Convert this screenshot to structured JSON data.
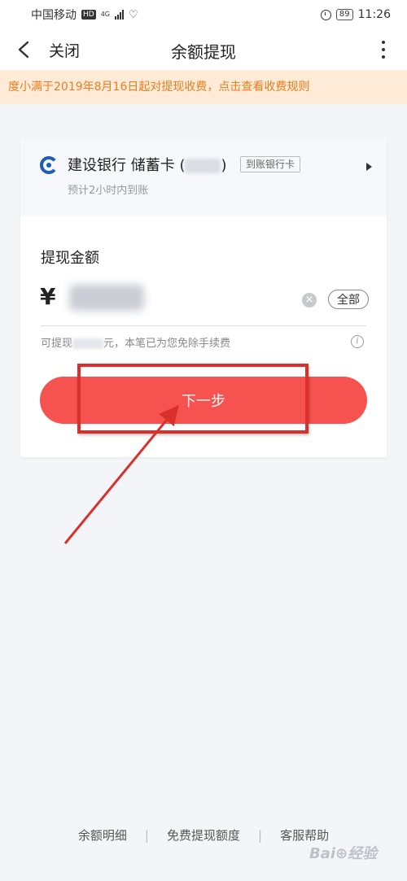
{
  "status_bar": {
    "carrier": "中国移动",
    "hd_badge": "HD",
    "network": "4G",
    "battery": "89",
    "time": "11:26"
  },
  "nav": {
    "close_label": "关闭",
    "title": "余额提现"
  },
  "notice": {
    "text": "度小满于2019年8月16日起对提现收费，点击查看收费规则",
    "color": "#f07c1b"
  },
  "bank": {
    "name": "建设银行 储蓄卡 (",
    "name_close": ")",
    "tag": "到账银行卡",
    "arrival": "预计2小时内到账"
  },
  "amount": {
    "label": "提现金额",
    "currency": "¥",
    "all_button": "全部",
    "available_prefix": "可提现",
    "available_suffix": "元，本笔已为您免除手续费"
  },
  "next_button": {
    "label": "下一步",
    "color": "#f6524f"
  },
  "footer": {
    "links": [
      "余额明细",
      "免费提现额度",
      "客服帮助"
    ],
    "separator": "|"
  },
  "annotation": {
    "color": "#d9302c"
  }
}
